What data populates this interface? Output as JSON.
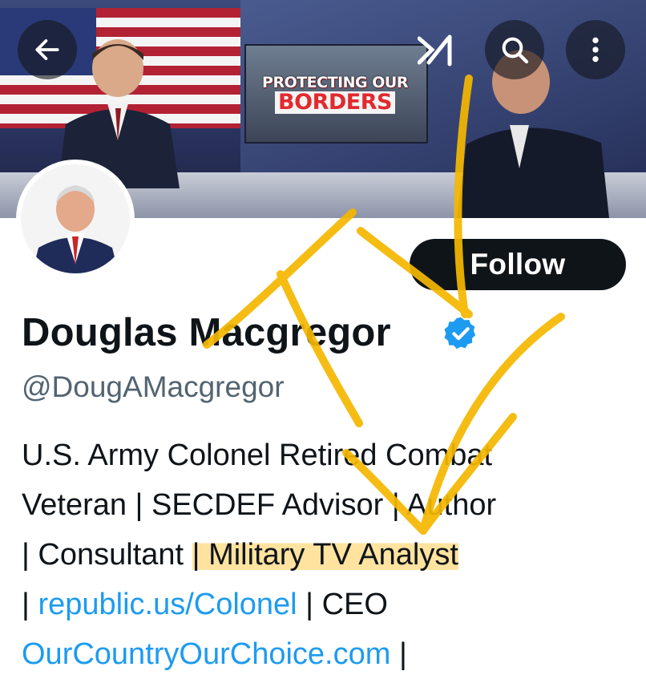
{
  "banner": {
    "monitor_line1": "PROTECTING OUR",
    "monitor_line2": "BORDERS"
  },
  "toolbar": {
    "back_icon": "back-arrow-icon",
    "grok_icon": "grok-logo-icon",
    "search_icon": "search-icon",
    "more_icon": "more-vertical-icon"
  },
  "profile": {
    "display_name": "Douglas Macgregor",
    "handle": "@DougAMacgregor",
    "follow_label": "Follow",
    "verified_icon": "verified-badge-icon",
    "verified_color": "#1d9bf0"
  },
  "bio": {
    "line1": "U.S. Army Colonel Retired Combat",
    "line2": "Veteran | SECDEF Advisor | Author",
    "line3_prefix": "| Consultant ",
    "line3_highlight": "| Military TV Analyst",
    "line4_prefix": "| ",
    "line4_link": "republic.us/Colonel",
    "line4_suffix": " |  CEO",
    "line5_link": "OurCountryOurChoice.com",
    "line5_suffix": " |"
  },
  "colors": {
    "link": "#1d9bf0",
    "secondary_text": "#536471",
    "annotation": "#f5b700",
    "highlight": "#ffcc50"
  }
}
